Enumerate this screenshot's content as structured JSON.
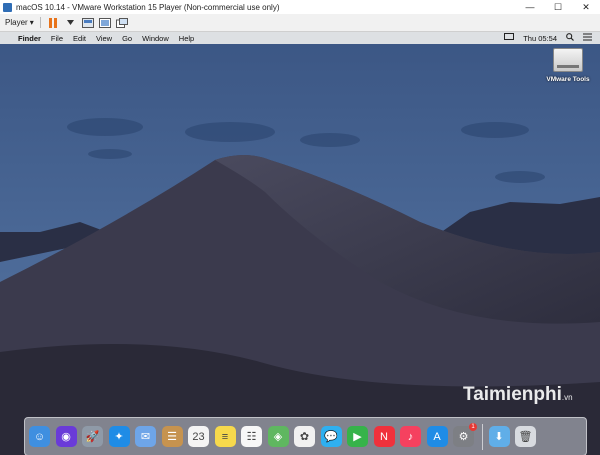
{
  "window": {
    "title": "macOS 10.14 - VMware Workstation 15 Player (Non-commercial use only)",
    "minimize": "—",
    "maximize": "☐",
    "close": "✕"
  },
  "toolbar": {
    "player_label": "Player",
    "player_arrow": "▾"
  },
  "menubar": {
    "apple": "",
    "items": [
      "Finder",
      "File",
      "Edit",
      "View",
      "Go",
      "Window",
      "Help"
    ],
    "clock": "Thu 05:54"
  },
  "desktop": {
    "vmware_tools_label": "VMware Tools"
  },
  "watermark": {
    "brand": "Taimienphi",
    "suffix": ".vn"
  },
  "dock": {
    "items": [
      {
        "name": "finder-icon",
        "color": "#3f8fe0",
        "glyph": "☺"
      },
      {
        "name": "siri-icon",
        "color": "#6a3bd8",
        "glyph": "◉"
      },
      {
        "name": "launchpad-icon",
        "color": "#8f9aa8",
        "glyph": "🚀"
      },
      {
        "name": "safari-icon",
        "color": "#1f8ce6",
        "glyph": "✦"
      },
      {
        "name": "mail-icon",
        "color": "#6ea5e8",
        "glyph": "✉"
      },
      {
        "name": "contacts-icon",
        "color": "#c6934f",
        "glyph": "☰"
      },
      {
        "name": "calendar-icon",
        "color": "#f4f4f4",
        "glyph": "23"
      },
      {
        "name": "notes-icon",
        "color": "#f6d94c",
        "glyph": "≡"
      },
      {
        "name": "reminders-icon",
        "color": "#f7f7f7",
        "glyph": "☷"
      },
      {
        "name": "maps-icon",
        "color": "#5fb760",
        "glyph": "◈"
      },
      {
        "name": "photos-icon",
        "color": "#f1f1f1",
        "glyph": "✿"
      },
      {
        "name": "messages-icon",
        "color": "#2fb0f0",
        "glyph": "💬"
      },
      {
        "name": "facetime-icon",
        "color": "#36b34a",
        "glyph": "▶"
      },
      {
        "name": "news-icon",
        "color": "#f0313c",
        "glyph": "N"
      },
      {
        "name": "music-icon",
        "color": "#f5415f",
        "glyph": "♪"
      },
      {
        "name": "app-store-icon",
        "color": "#1f8ce6",
        "glyph": "A"
      },
      {
        "name": "system-preferences-icon",
        "color": "#7d7f84",
        "glyph": "⚙",
        "badge": "1"
      },
      {
        "name": "downloads-folder-icon",
        "color": "#60aee8",
        "glyph": "⬇"
      },
      {
        "name": "trash-icon",
        "color": "#d8dbe0",
        "glyph": "🗑"
      }
    ]
  }
}
